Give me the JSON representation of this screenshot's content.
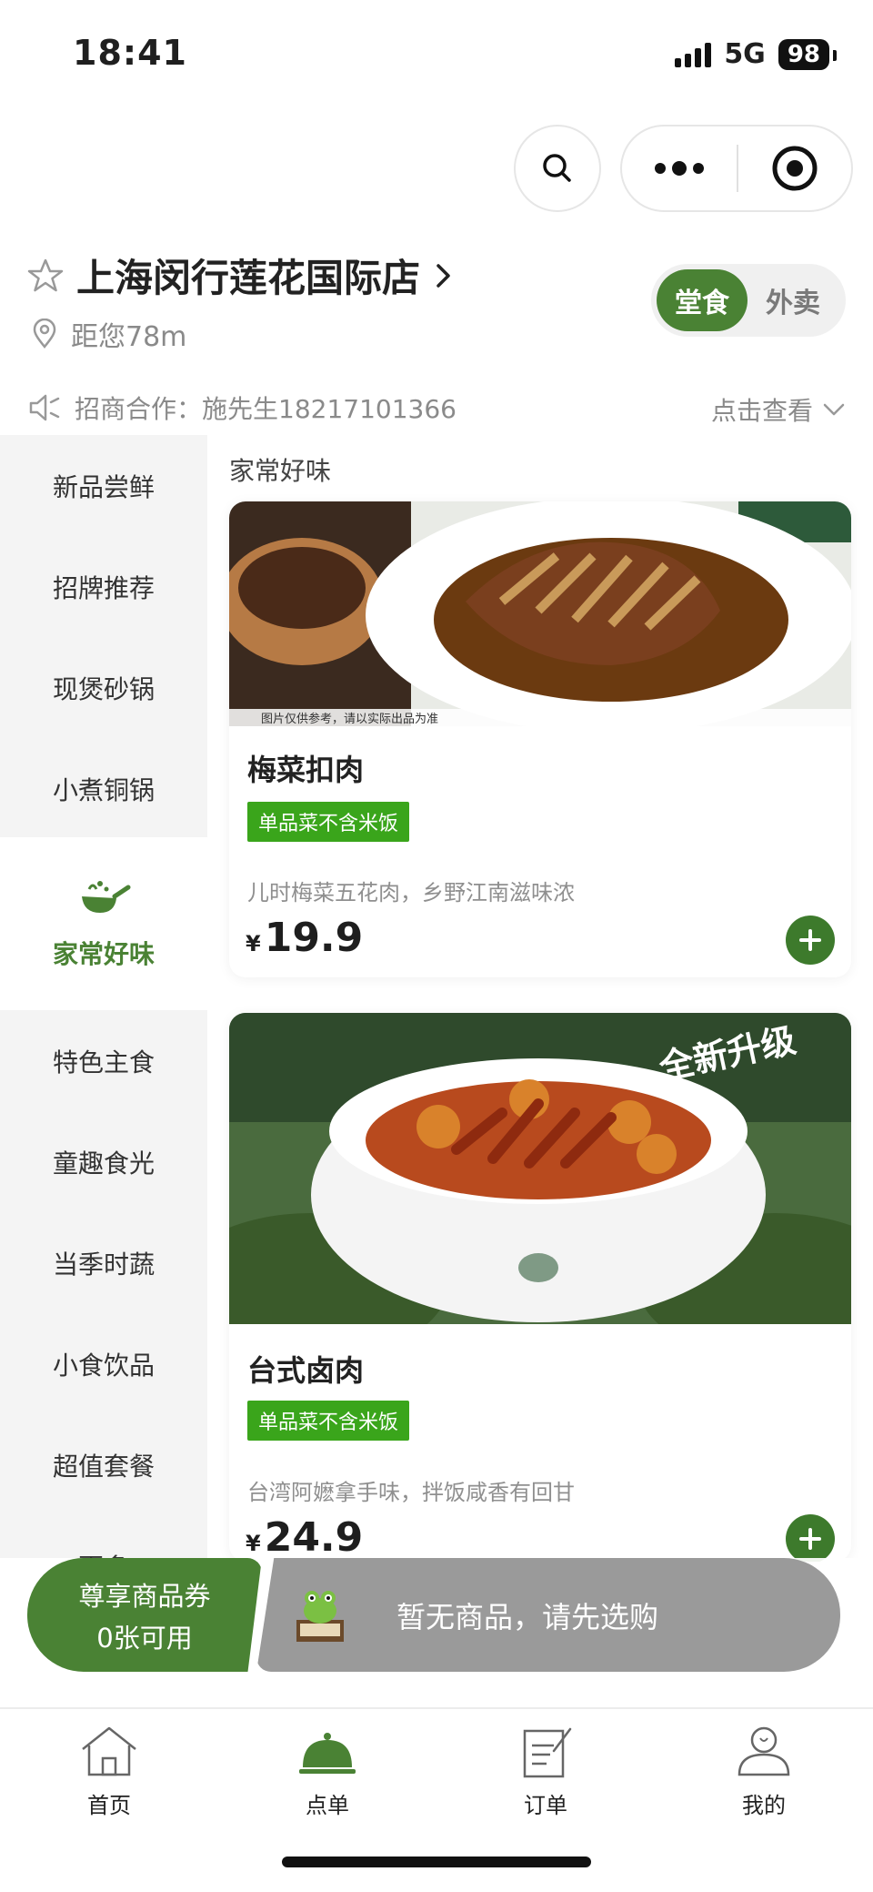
{
  "status_bar": {
    "time": "18:41",
    "network": "5G",
    "battery": "98"
  },
  "store": {
    "name": "上海闵行莲花国际店",
    "distance": "距您78m",
    "modes": [
      "堂食",
      "外卖"
    ],
    "active_mode": "堂食"
  },
  "notice": {
    "text": "招商合作：施先生18217101366",
    "more": "点击查看"
  },
  "categories": {
    "items": [
      "新品尝鲜",
      "招牌推荐",
      "现煲砂锅",
      "小煮铜锅",
      "家常好味",
      "特色主食",
      "童趣食光",
      "当季时蔬",
      "小食饮品",
      "超值套餐",
      "更多"
    ],
    "active": "家常好味"
  },
  "section_title": "家常好味",
  "dishes": [
    {
      "name": "梅菜扣肉",
      "tag": "单品菜不含米饭",
      "desc": "儿时梅菜五花肉，乡野江南滋味浓",
      "currency": "¥",
      "price": "19.9",
      "photo_note": "图片仅供参考，请以实际出品为准"
    },
    {
      "name": "台式卤肉",
      "tag": "单品菜不含米饭",
      "desc": "台湾阿嬷拿手味，拌饭咸香有回甘",
      "currency": "¥",
      "price": "24.9",
      "photo_badge": "全新升级"
    }
  ],
  "coupon": {
    "title": "尊享商品券",
    "count": "0张可用"
  },
  "cart": {
    "empty_text": "暂无商品，请先选购"
  },
  "tabbar": {
    "items": [
      "首页",
      "点单",
      "订单",
      "我的"
    ],
    "active": "点单"
  },
  "colors": {
    "brand_green": "#4a8234",
    "tag_green": "#3aa51b",
    "cart_gray": "#9a9a9a"
  }
}
